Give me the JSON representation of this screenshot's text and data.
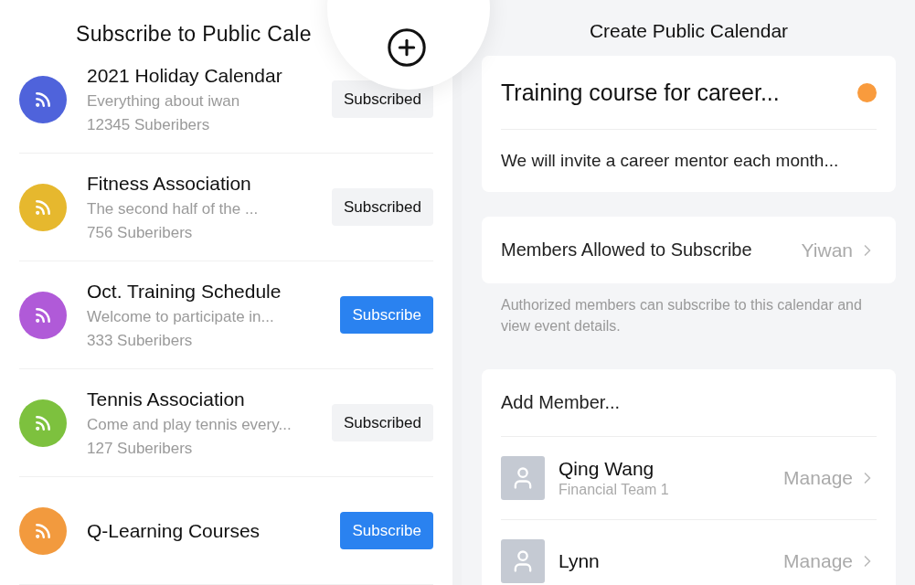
{
  "subscribe_panel": {
    "title": "Subscribe to Public Cale",
    "calendars": [
      {
        "name": "2021 Holiday Calendar",
        "description": "Everything about iwan",
        "subscribers": "12345 Suberibers",
        "color": "#4f63db",
        "subscribed": true,
        "button": "Subscribed"
      },
      {
        "name": "Fitness Association",
        "description": "The second half of the ...",
        "subscribers": "756 Suberibers",
        "color": "#e6b82e",
        "subscribed": true,
        "button": "Subscribed"
      },
      {
        "name": "Oct. Training Schedule",
        "description": "Welcome to participate in...",
        "subscribers": "333 Suberibers",
        "color": "#b05ad8",
        "subscribed": false,
        "button": "Subscribe"
      },
      {
        "name": "Tennis Association",
        "description": "Come and play tennis every...",
        "subscribers": "127 Suberibers",
        "color": "#7dc13e",
        "subscribed": true,
        "button": "Subscribed"
      },
      {
        "name": "Q-Learning Courses",
        "color": "#f29a3e",
        "subscribed": false,
        "button": "Subscribe"
      }
    ]
  },
  "create_panel": {
    "title": "Create Public Calendar",
    "calendar": {
      "name": "Training course for career...",
      "color": "#f99b3d",
      "description": "We will invite a career mentor each month..."
    },
    "members_allowed": {
      "label": "Members Allowed to Subscribe",
      "value": "Yiwan"
    },
    "note": "Authorized members can subscribe to this calendar and view event details.",
    "add_member": "Add Member...",
    "members": [
      {
        "name": "Qing Wang",
        "team": "Financial Team 1",
        "action": "Manage"
      },
      {
        "name": "Lynn",
        "action": "Manage"
      }
    ]
  }
}
